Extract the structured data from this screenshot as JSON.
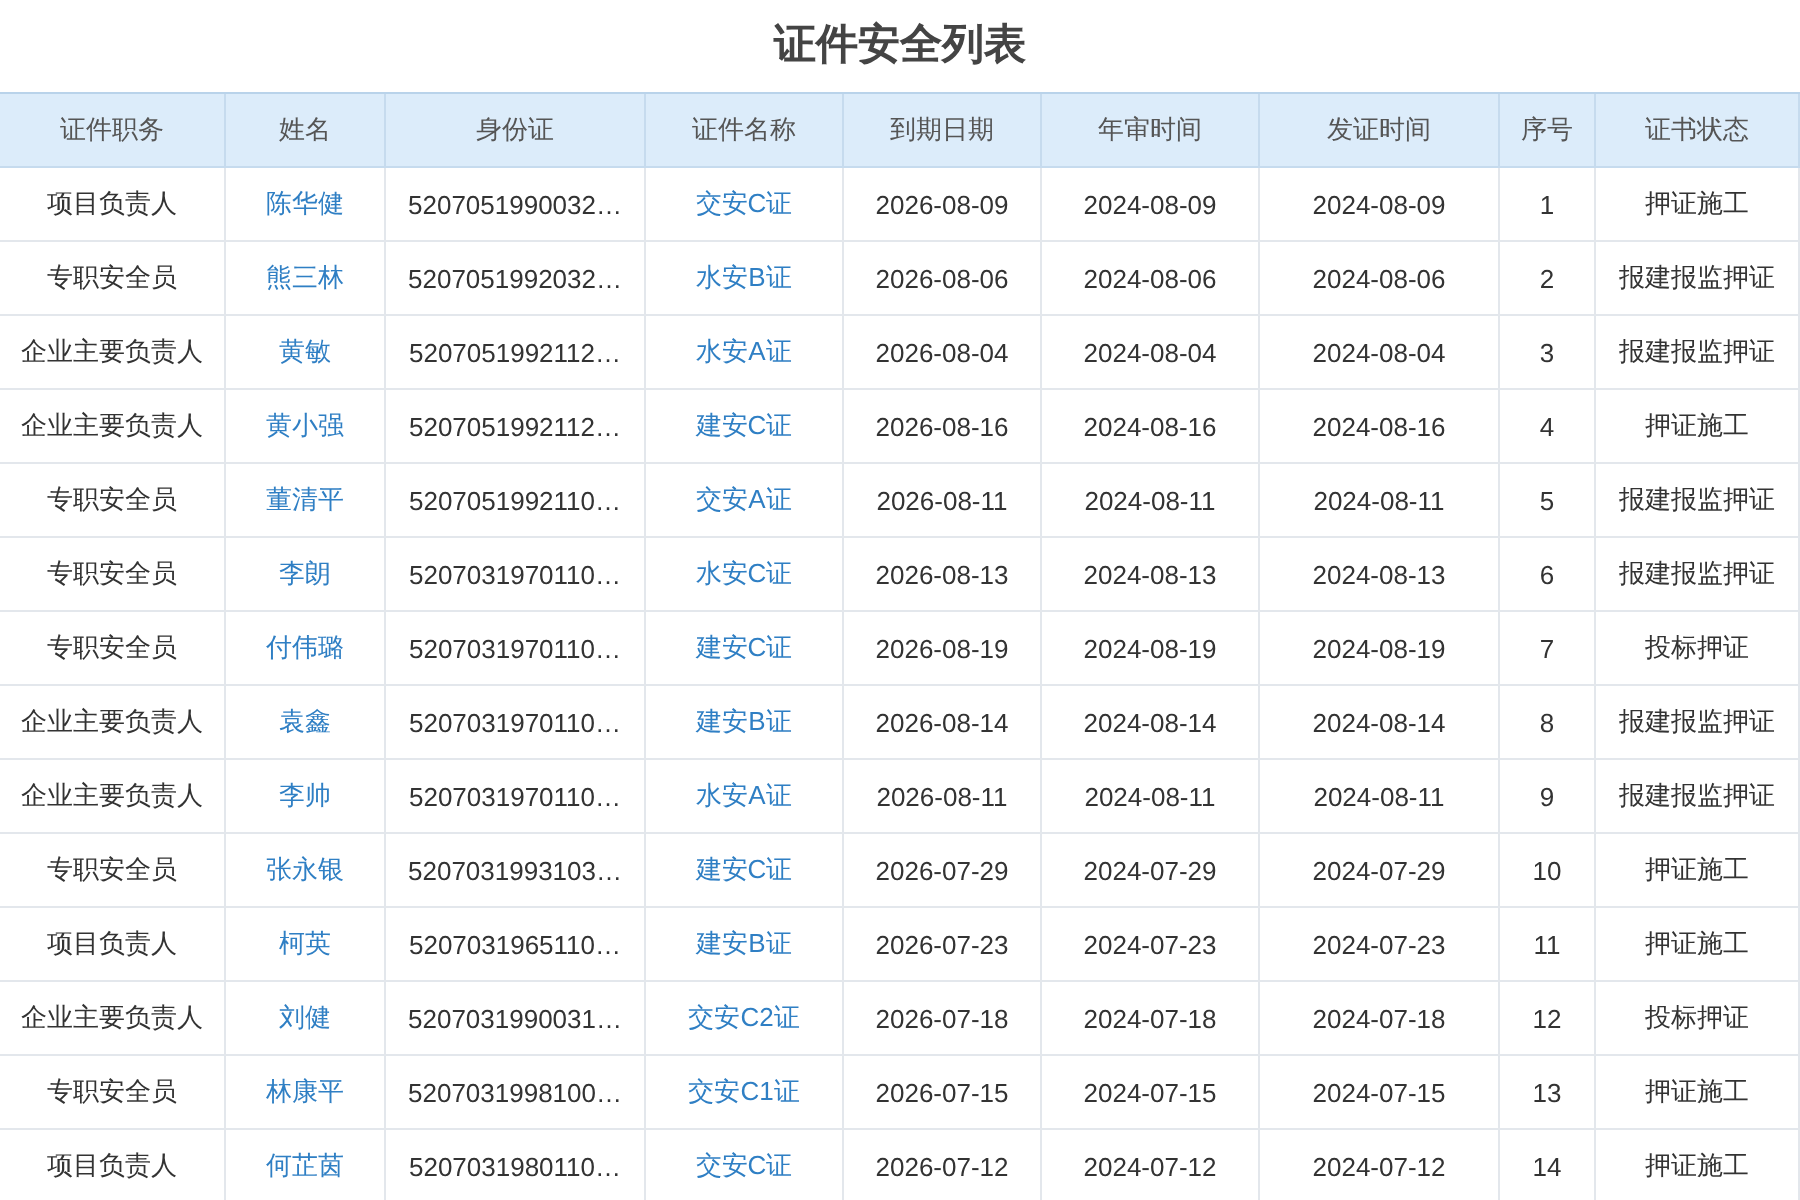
{
  "title": "证件安全列表",
  "table": {
    "columns": [
      "证件职务",
      "姓名",
      "身份证",
      "证件名称",
      "到期日期",
      "年审时间",
      "发证时间",
      "序号",
      "证书状态"
    ],
    "rows": [
      [
        "项目负责人",
        "陈华健",
        "5207051990032…",
        "交安C证",
        "2026-08-09",
        "2024-08-09",
        "2024-08-09",
        "1",
        "押证施工"
      ],
      [
        "专职安全员",
        "熊三林",
        "5207051992032…",
        "水安B证",
        "2026-08-06",
        "2024-08-06",
        "2024-08-06",
        "2",
        "报建报监押证"
      ],
      [
        "企业主要负责人",
        "黄敏",
        "5207051992112…",
        "水安A证",
        "2026-08-04",
        "2024-08-04",
        "2024-08-04",
        "3",
        "报建报监押证"
      ],
      [
        "企业主要负责人",
        "黄小强",
        "5207051992112…",
        "建安C证",
        "2026-08-16",
        "2024-08-16",
        "2024-08-16",
        "4",
        "押证施工"
      ],
      [
        "专职安全员",
        "董清平",
        "5207051992110…",
        "交安A证",
        "2026-08-11",
        "2024-08-11",
        "2024-08-11",
        "5",
        "报建报监押证"
      ],
      [
        "专职安全员",
        "李朗",
        "5207031970110…",
        "水安C证",
        "2026-08-13",
        "2024-08-13",
        "2024-08-13",
        "6",
        "报建报监押证"
      ],
      [
        "专职安全员",
        "付伟璐",
        "5207031970110…",
        "建安C证",
        "2026-08-19",
        "2024-08-19",
        "2024-08-19",
        "7",
        "投标押证"
      ],
      [
        "企业主要负责人",
        "袁鑫",
        "5207031970110…",
        "建安B证",
        "2026-08-14",
        "2024-08-14",
        "2024-08-14",
        "8",
        "报建报监押证"
      ],
      [
        "企业主要负责人",
        "李帅",
        "5207031970110…",
        "水安A证",
        "2026-08-11",
        "2024-08-11",
        "2024-08-11",
        "9",
        "报建报监押证"
      ],
      [
        "专职安全员",
        "张永银",
        "5207031993103…",
        "建安C证",
        "2026-07-29",
        "2024-07-29",
        "2024-07-29",
        "10",
        "押证施工"
      ],
      [
        "项目负责人",
        "柯英",
        "5207031965110…",
        "建安B证",
        "2026-07-23",
        "2024-07-23",
        "2024-07-23",
        "11",
        "押证施工"
      ],
      [
        "企业主要负责人",
        "刘健",
        "5207031990031…",
        "交安C2证",
        "2026-07-18",
        "2024-07-18",
        "2024-07-18",
        "12",
        "投标押证"
      ],
      [
        "专职安全员",
        "林康平",
        "5207031998100…",
        "交安C1证",
        "2026-07-15",
        "2024-07-15",
        "2024-07-15",
        "13",
        "押证施工"
      ],
      [
        "项目负责人",
        "何芷茵",
        "5207031980110…",
        "交安C证",
        "2026-07-12",
        "2024-07-12",
        "2024-07-12",
        "14",
        "押证施工"
      ]
    ]
  }
}
